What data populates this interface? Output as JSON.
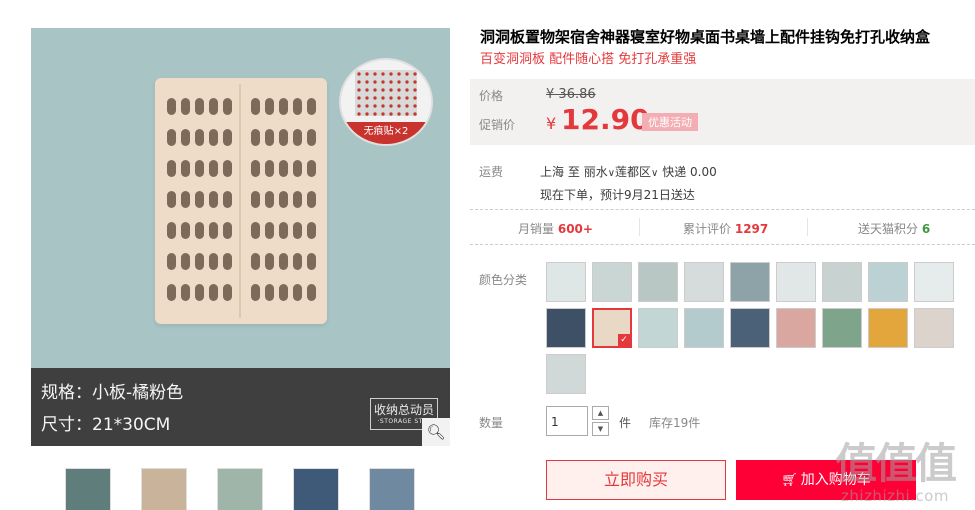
{
  "product": {
    "title": "洞洞板置物架宿舍神器寝室好物桌面书桌墙上配件挂钩免打孔收纳盒",
    "subtitle": "百变洞洞板 配件随心搭 免打孔承重强"
  },
  "gallery": {
    "spec_line1": "规格：小板-橘粉色",
    "spec_line2": "尺寸：21*30CM",
    "sticker_label": "无痕贴×2",
    "brand_text": "收纳总动员",
    "brand_subtext": "·STORAGE STO·",
    "zoom_icon": "magnifier-icon",
    "thumbnail_count": 5
  },
  "price": {
    "price_label": "价格",
    "currency": "¥",
    "original": "36.86",
    "promo_label": "促销价",
    "current": "12.90",
    "promo_tag": "优惠活动"
  },
  "shipping": {
    "label": "运费",
    "origin": "上海",
    "to": "至",
    "city": "丽水",
    "district": "莲都区",
    "fee": "快递 0.00",
    "eta": "现在下单，预计9月21日送达"
  },
  "stats": {
    "monthly_label": "月销量",
    "monthly_value": "600+",
    "reviews_label": "累计评价",
    "reviews_value": "1297",
    "points_label": "送天猫积分",
    "points_value": "6"
  },
  "sku": {
    "label": "颜色分类",
    "count": 19,
    "selected_index": 10
  },
  "quantity": {
    "label": "数量",
    "value": "1",
    "unit": "件",
    "stock": "库存19件"
  },
  "actions": {
    "buy_now": "立即购买",
    "add_to_cart": "加入购物车",
    "cart_icon": "cart-icon"
  },
  "watermark": {
    "logo": "值值值",
    "url": "zhizhizhi.com"
  },
  "colors": {
    "accent": "#e4393c",
    "cart": "#ff0036",
    "price_bg": "#f3f0f0"
  }
}
